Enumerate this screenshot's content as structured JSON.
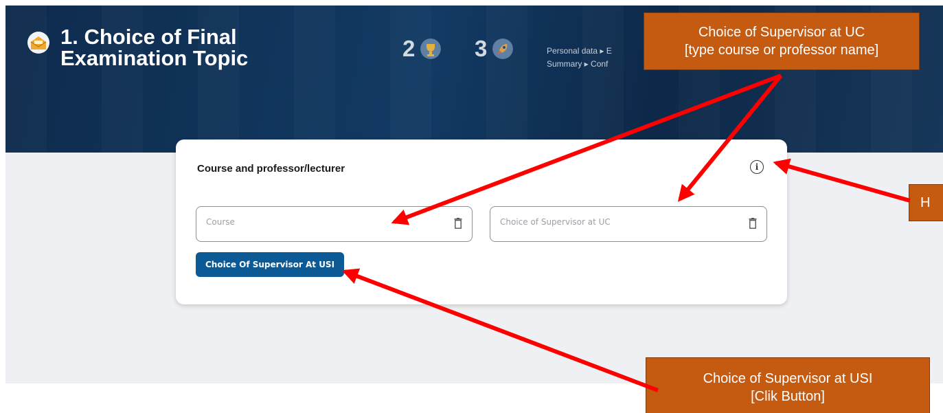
{
  "header": {
    "title": "1. Choice of Final Examination Topic",
    "step_icon": "envelope-icon",
    "steps": [
      {
        "number": "2",
        "icon": "trophy-icon"
      },
      {
        "number": "3",
        "icon": "rocket-icon"
      }
    ],
    "breadcrumb_line1": "Personal data ▸ E",
    "breadcrumb_line2": "Summary ▸ Conf"
  },
  "card": {
    "title": "Course and professor/lecturer",
    "info_icon": "info-icon",
    "course_field": {
      "placeholder": "Course",
      "value": ""
    },
    "supervisor_field": {
      "placeholder": "Choice of Supervisor at UC",
      "value": ""
    },
    "usi_button_label": "Choice Of Supervisor At USI"
  },
  "annotations": {
    "uc_line1": "Choice of Supervisor at UC",
    "uc_line2": "[type course or professor name]",
    "help_label": "H",
    "usi_line1": "Choice of Supervisor at USI",
    "usi_line2": "[Clik Button]"
  },
  "colors": {
    "header_bg": "#0e2b4d",
    "button_bg": "#0b5a96",
    "callout_bg": "#c55a11",
    "arrow": "#ff0000"
  }
}
